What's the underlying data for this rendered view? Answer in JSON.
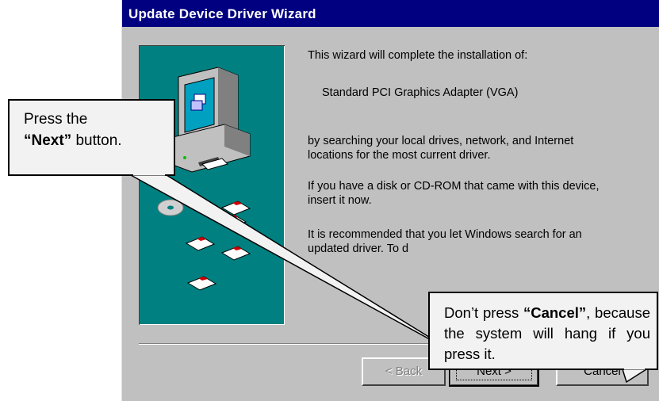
{
  "window": {
    "title": "Update Device Driver Wizard"
  },
  "content": {
    "intro": "This wizard will complete the installation of:",
    "device_name": "Standard PCI Graphics Adapter (VGA)",
    "search_desc_1": "by searching your local drives, network, and Internet",
    "search_desc_2": "locations for the most current driver.",
    "disk_line_1": "If you have a disk or CD-ROM that came with this device,",
    "disk_line_2": "insert it now.",
    "recommend_line_1": "It is recommended that you let Windows search for an",
    "recommend_line_2": "updated driver. To d"
  },
  "buttons": {
    "back": "< Back",
    "next": "Next >",
    "cancel": "Cancel"
  },
  "callouts": {
    "next": {
      "line1": "Press the",
      "keyword": "“Next”",
      "rest": " button."
    },
    "cancel": {
      "prefix": "Don’t press ",
      "keyword": "“Cancel”",
      "suffix": ", because the system will hang if you press it."
    }
  },
  "icons": {
    "art": "computer-with-disks-illustration"
  },
  "colors": {
    "title_bar": "#000080",
    "panel_bg": "#008080",
    "dialog_bg": "#c0c0c0",
    "callout_bg": "#f2f2f2"
  }
}
